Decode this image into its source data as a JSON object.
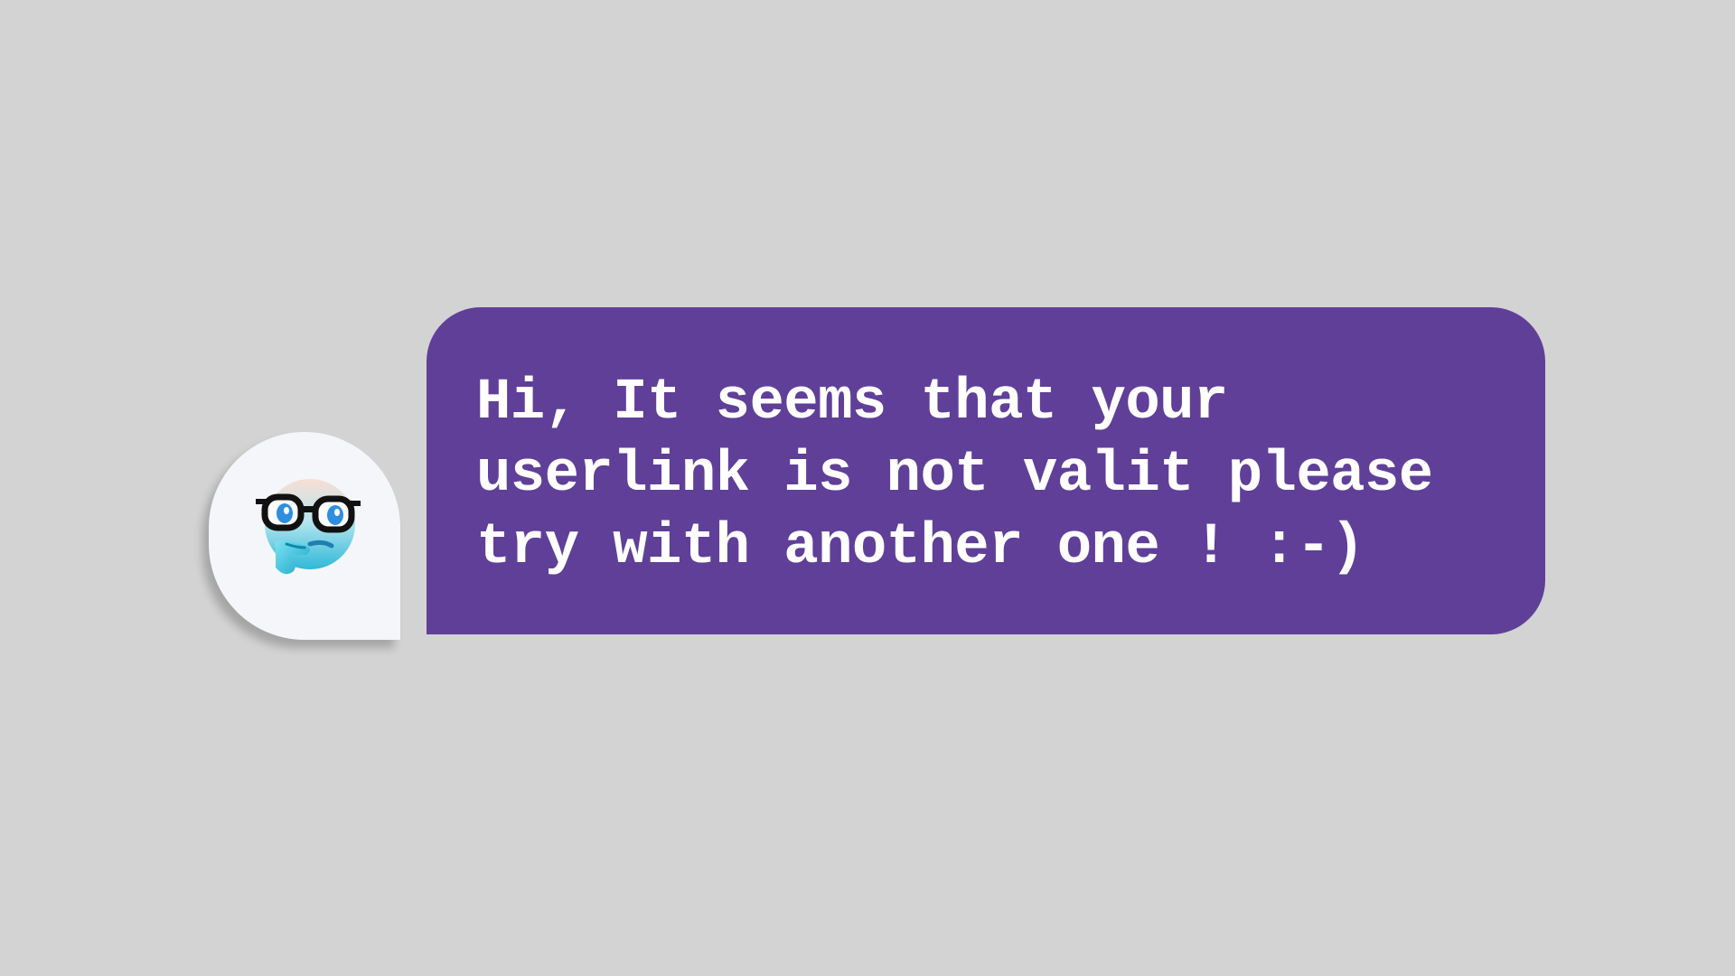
{
  "chat": {
    "avatar": {
      "icon": "nerd-thinking-face-icon"
    },
    "message": {
      "text": "Hi, It seems that your\nuserlink is not valit please\ntry with another one ! :-)"
    }
  },
  "colors": {
    "background": "#d3d3d3",
    "bubble": "#603f99",
    "avatar_bg": "#f4f6f9",
    "text": "#ffffff"
  }
}
